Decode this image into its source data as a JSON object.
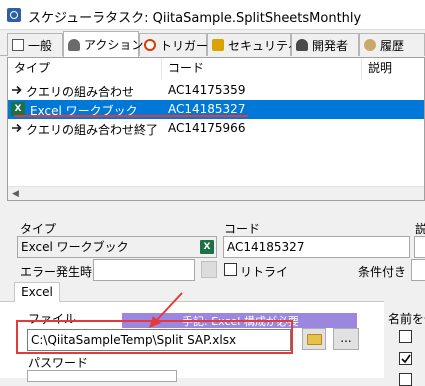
{
  "window": {
    "title": "スケジューラタスク: QiitaSample.SplitSheetsMonthly"
  },
  "tabs": [
    {
      "label": "一般"
    },
    {
      "label": "アクション"
    },
    {
      "label": "トリガー"
    },
    {
      "label": "セキュリティ"
    },
    {
      "label": "開発者"
    },
    {
      "label": "履歴"
    }
  ],
  "list": {
    "headers": {
      "type": "タイプ",
      "code": "コード",
      "desc": "説明"
    },
    "rows": [
      {
        "type": "クエリの組み合わせ",
        "code": "AC14175359"
      },
      {
        "type": "Excel ワークブック",
        "code": "AC14185327"
      },
      {
        "type": "クエリの組み合わせ終了",
        "code": "AC14175966"
      }
    ]
  },
  "form": {
    "type_label": "タイプ",
    "type_value": "Excel ワークブック",
    "code_label": "コード",
    "code_value": "AC14185327",
    "desc_label_partial": "説",
    "error_label": "エラー発生時",
    "retry_label": "リトライ",
    "condition_label": "条件付き",
    "subtab_label": "Excel",
    "file_label": "ファイル",
    "file_value": "C:\\QiitaSampleTemp\\Split SAP.xlsx",
    "browse_label": "...",
    "password_label": "パスワード",
    "right_label": "名前を付"
  },
  "annotation": {
    "text": "手記: Excel 構成が必要",
    "color": "#e53a3a",
    "band_color": "#9b86e0"
  },
  "colors": {
    "selection": "#0078d7",
    "excel_green": "#1e7145"
  }
}
